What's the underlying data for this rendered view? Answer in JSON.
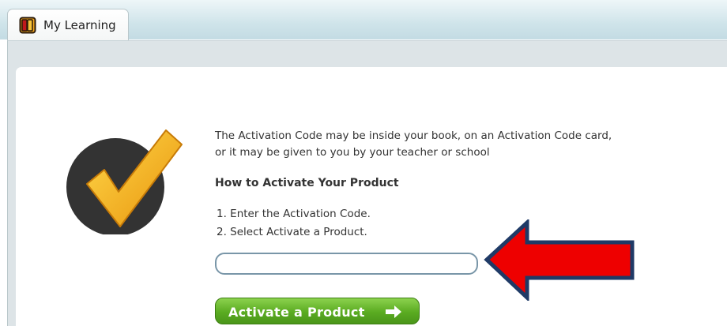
{
  "tab": {
    "label": "My Learning",
    "icon": "book-icon"
  },
  "main": {
    "badge_icon": "checkmark-badge-icon",
    "description": "The Activation Code may be inside your book, on an Activation Code card, or it may be given to you by your teacher or school",
    "heading": "How to Activate Your Product",
    "steps": [
      "1. Enter the Activation Code.",
      "2. Select Activate a Product."
    ],
    "code_input": {
      "value": "",
      "placeholder": ""
    },
    "activate_button": {
      "label": "Activate a Product",
      "icon": "arrow-right-icon"
    },
    "annotation_arrow": {
      "icon": "red-arrow-icon",
      "color": "#ee0000",
      "outline": "#1f3a66"
    }
  },
  "colors": {
    "header_bg": "#cfe4ea",
    "panel_bg": "#dde4e7",
    "button_green": "#5aab21",
    "check_yellow": "#f5b917",
    "badge_dark": "#333333"
  }
}
